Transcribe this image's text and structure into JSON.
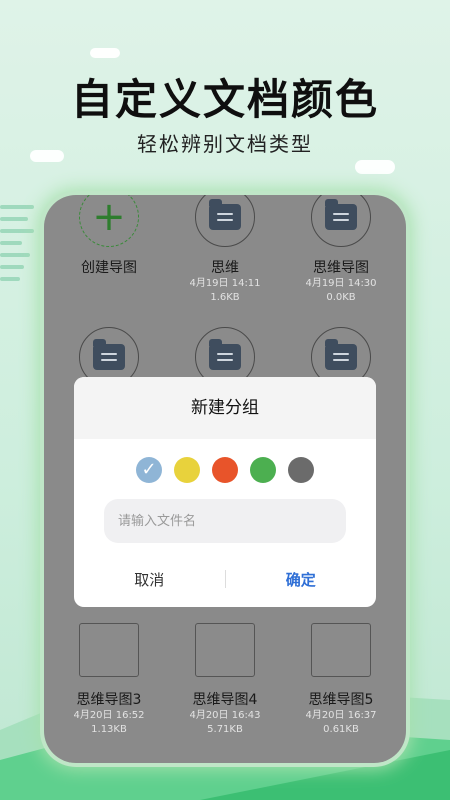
{
  "promo": {
    "headline": "自定义文档颜色",
    "subline": "轻松辨别文档类型"
  },
  "grid": {
    "create_label": "创建导图",
    "row1": [
      {
        "name": "思维",
        "date": "4月19日 14:11",
        "size": "1.6KB"
      },
      {
        "name": "思维导图",
        "date": "4月19日 14:30",
        "size": "0.0KB"
      }
    ],
    "row3": [
      {
        "name": "思维导图3",
        "date": "4月20日 16:52",
        "size": "1.13KB"
      },
      {
        "name": "思维导图4",
        "date": "4月20日 16:43",
        "size": "5.71KB"
      },
      {
        "name": "思维导图5",
        "date": "4月20日 16:37",
        "size": "0.61KB"
      }
    ]
  },
  "dialog": {
    "title": "新建分组",
    "selected_color": "#8fb5d6",
    "colors": [
      "#8fb5d6",
      "#e8d23c",
      "#e8542a",
      "#4caf50",
      "#6b6b6b"
    ],
    "input_placeholder": "请输入文件名",
    "input_value": "",
    "cancel_label": "取消",
    "ok_label": "确定"
  },
  "icons": {
    "create": "plus-icon",
    "folder": "folder-icon",
    "mindmap": "mindmap-thumbnail-icon",
    "selected": "check-icon"
  }
}
